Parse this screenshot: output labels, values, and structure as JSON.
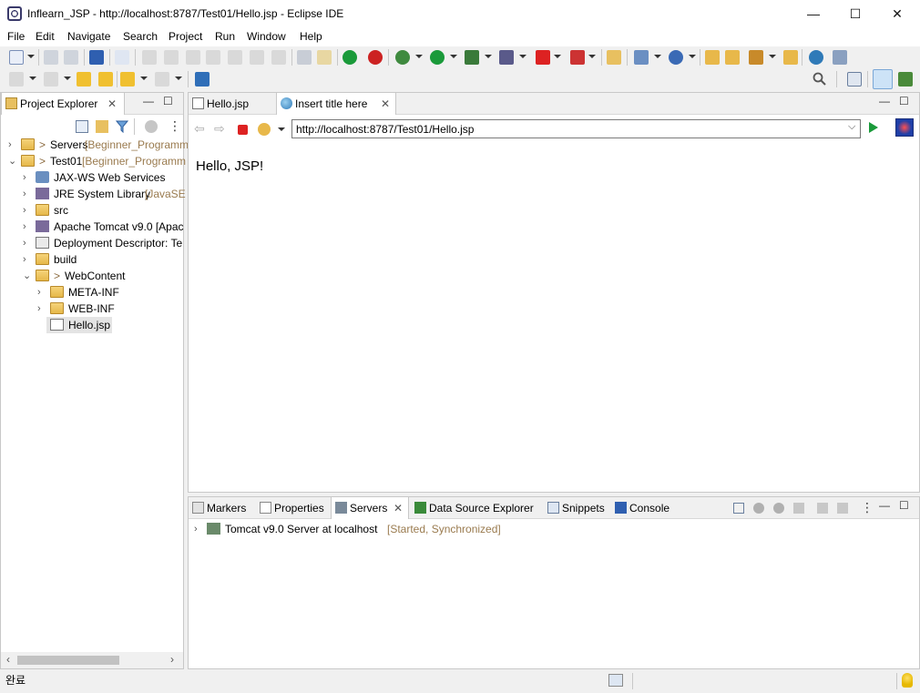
{
  "window": {
    "title": "Inflearn_JSP - http://localhost:8787/Test01/Hello.jsp - Eclipse IDE",
    "minimize": "—",
    "maximize": "☐",
    "close": "✕"
  },
  "menu": [
    "File",
    "Edit",
    "Navigate",
    "Search",
    "Project",
    "Run",
    "Window",
    "Help"
  ],
  "explorer": {
    "tab": "Project Explorer",
    "items": [
      {
        "chev": "›",
        "prefix": "> ",
        "label": "Servers",
        "suffix": " [Beginner_Programm"
      },
      {
        "chev": "⌄",
        "prefix": "> ",
        "label": "Test01",
        "suffix": " [Beginner_Programm"
      },
      {
        "chev": "›",
        "prefix": "",
        "label": "JAX-WS Web Services",
        "suffix": ""
      },
      {
        "chev": "›",
        "prefix": "",
        "label": "JRE System Library",
        "suffix": " [JavaSE"
      },
      {
        "chev": "›",
        "prefix": "",
        "label": "src",
        "suffix": ""
      },
      {
        "chev": "›",
        "prefix": "",
        "label": "Apache Tomcat v9.0 [Apac",
        "suffix": ""
      },
      {
        "chev": "›",
        "prefix": "",
        "label": "Deployment Descriptor: Te",
        "suffix": ""
      },
      {
        "chev": "›",
        "prefix": "",
        "label": "build",
        "suffix": ""
      },
      {
        "chev": "⌄",
        "prefix": "> ",
        "label": "WebContent",
        "suffix": ""
      },
      {
        "chev": "›",
        "prefix": "",
        "label": "META-INF",
        "suffix": ""
      },
      {
        "chev": "›",
        "prefix": "",
        "label": "WEB-INF",
        "suffix": ""
      },
      {
        "chev": "",
        "prefix": "",
        "label": "Hello.jsp",
        "suffix": ""
      }
    ]
  },
  "editor": {
    "tabs": [
      "Hello.jsp",
      "Insert title here"
    ],
    "url": "http://localhost:8787/Test01/Hello.jsp",
    "content": "Hello, JSP!"
  },
  "bottom": {
    "tabs": [
      "Markers",
      "Properties",
      "Servers",
      "Data Source Explorer",
      "Snippets",
      "Console"
    ],
    "server": {
      "name": "Tomcat v9.0 Server at localhost",
      "state": "[Started, Synchronized]"
    }
  },
  "status": {
    "text": "완료"
  },
  "colors": {
    "accent": "#0b6bcb",
    "status_text": "#8b6a3e"
  }
}
